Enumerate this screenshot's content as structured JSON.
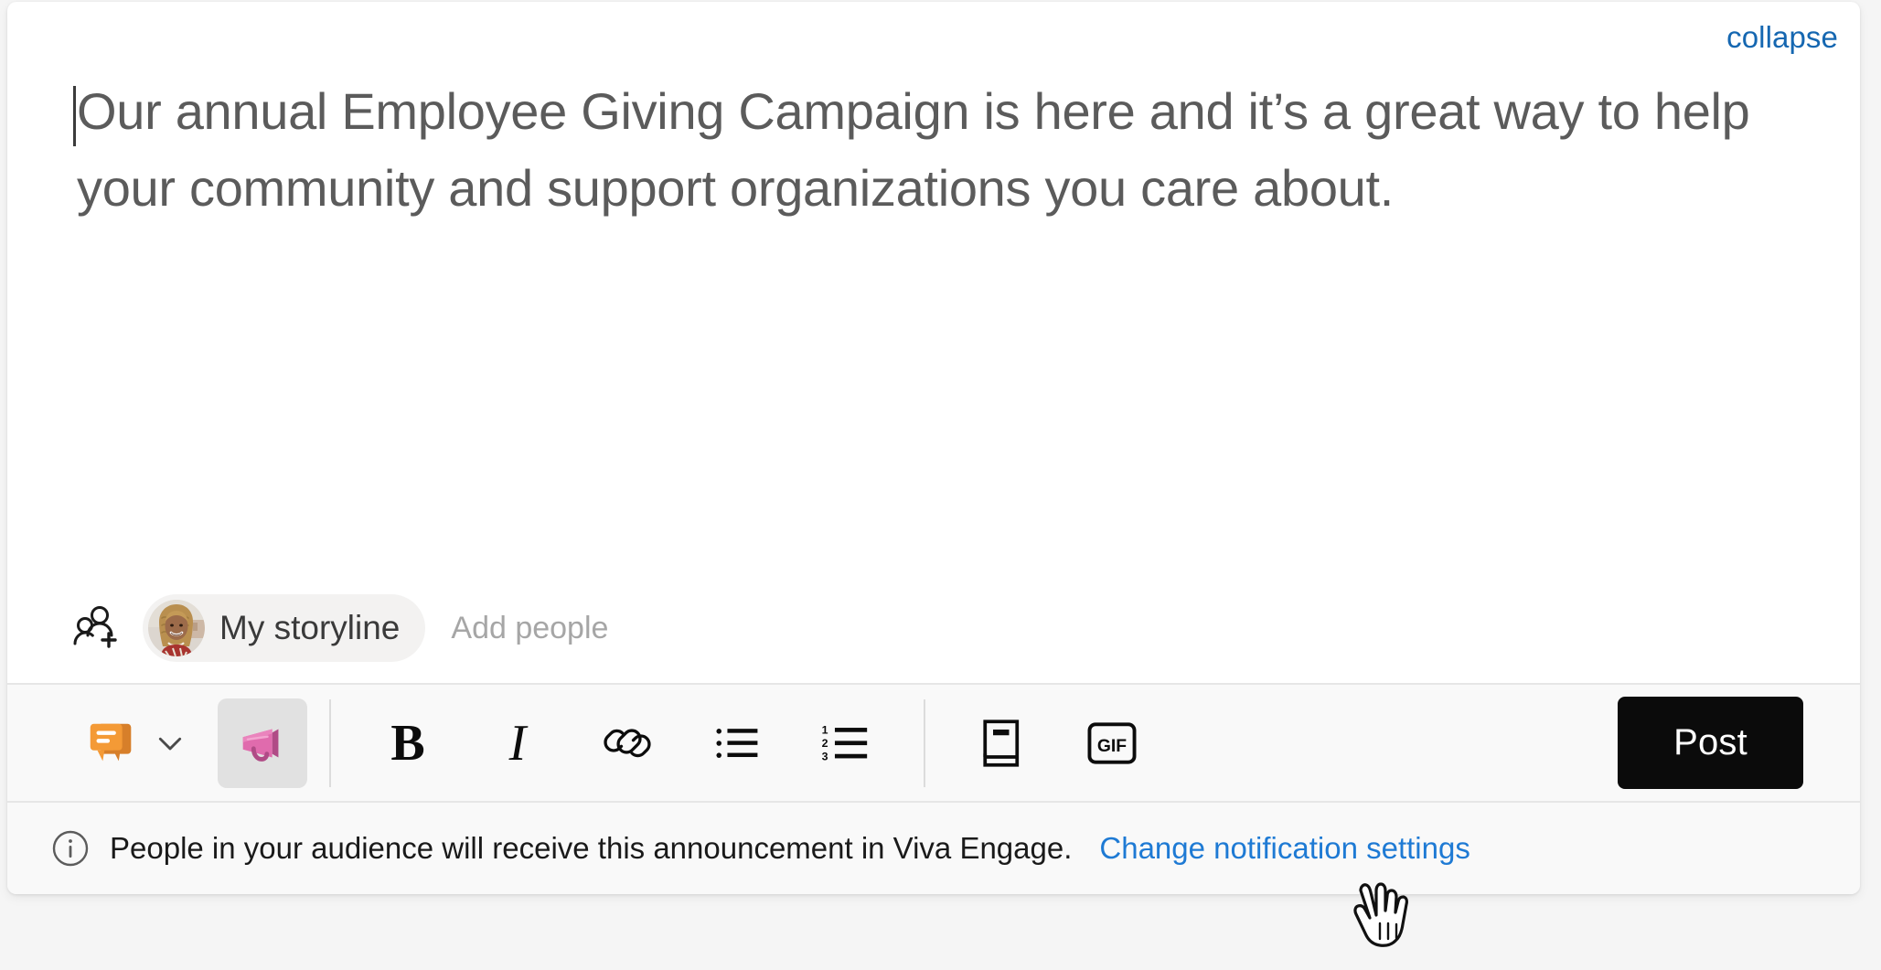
{
  "card": {
    "collapse_label": "collapse"
  },
  "editor": {
    "text": "Our annual Employee Giving Campaign is here and it’s a great way to help your community and support organizations you care about.",
    "caret_visible": true
  },
  "audience": {
    "add_people_icon": "add-people-icon",
    "chip_label": "My storyline",
    "chip_avatar_alt": "user-avatar",
    "add_people_placeholder": "Add people"
  },
  "toolbar": {
    "post_type_icon": "discussion-icon",
    "post_type_chevron_icon": "chevron-down-icon",
    "announcement_icon": "megaphone-icon",
    "announcement_selected": true,
    "items": [
      {
        "name": "bold-button",
        "glyph": "B",
        "icon": "bold-icon"
      },
      {
        "name": "italic-button",
        "glyph": "I",
        "icon": "italic-icon"
      },
      {
        "name": "link-button",
        "glyph": "",
        "icon": "link-icon"
      },
      {
        "name": "bulleted-list-button",
        "glyph": "",
        "icon": "bulleted-list-icon"
      },
      {
        "name": "numbered-list-button",
        "glyph": "",
        "icon": "numbered-list-icon"
      },
      {
        "name": "praise-button",
        "glyph": "",
        "icon": "book-icon"
      },
      {
        "name": "gif-button",
        "glyph": "GIF",
        "icon": "gif-icon"
      }
    ],
    "numbered_list_digits": [
      "1",
      "2",
      "3"
    ],
    "gif_label": "GIF",
    "post_label": "Post"
  },
  "notice": {
    "icon": "info-circle-icon",
    "text": "People in your audience will receive this announcement in Viva Engage.",
    "link_label": "Change notification settings"
  },
  "cursor": {
    "icon": "pointing-hand-cursor"
  },
  "colors": {
    "link_blue": "#1567b1",
    "notice_link_blue": "#1e7ad4",
    "post_button_bg": "#0b0b0b",
    "editor_text": "#5b5b5b",
    "discussion_orange": "#ef9035",
    "megaphone_pink": "#e06bad",
    "toolbar_bg": "#f9f9f9",
    "page_bg": "#f5f5f5"
  }
}
